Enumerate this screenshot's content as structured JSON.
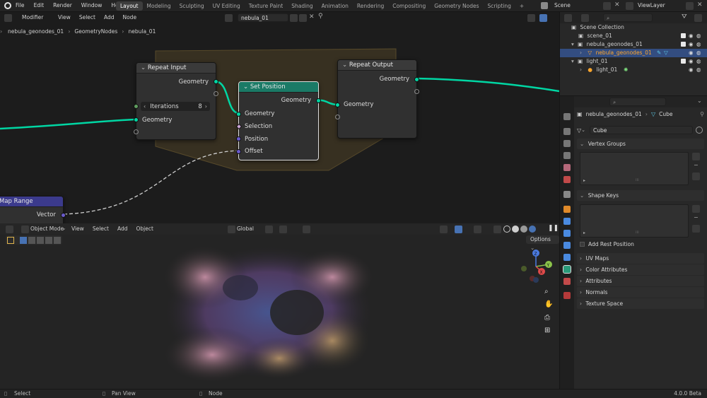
{
  "topbar": {
    "menu": [
      "File",
      "Edit",
      "Render",
      "Window",
      "Help"
    ],
    "workspaces": [
      "Layout",
      "Modeling",
      "Sculpting",
      "UV Editing",
      "Texture Paint",
      "Shading",
      "Animation",
      "Rendering",
      "Compositing",
      "Geometry Nodes",
      "Scripting"
    ],
    "active_workspace": "Layout",
    "add_workspace": "+",
    "scene": "Scene",
    "view_layer": "ViewLayer"
  },
  "node_editor": {
    "header": {
      "editor_type": "Modifier",
      "menus": [
        "View",
        "Select",
        "Add",
        "Node"
      ],
      "node_group": "nebula_01"
    },
    "breadcrumb": [
      "nebula_geonodes_01",
      "GeometryNodes",
      "nebula_01"
    ],
    "nodes": {
      "repeat_input": {
        "title": "Repeat Input",
        "out_geometry": "Geometry",
        "iterations_label": "Iterations",
        "iterations_value": "8",
        "in_geometry": "Geometry"
      },
      "set_position": {
        "title": "Set Position",
        "out_geometry": "Geometry",
        "in_geometry": "Geometry",
        "selection": "Selection",
        "position": "Position",
        "offset": "Offset"
      },
      "repeat_output": {
        "title": "Repeat Output",
        "out_geometry": "Geometry",
        "in_geometry": "Geometry"
      },
      "map_range": {
        "title": "Map Range",
        "out_vector": "Vector"
      }
    },
    "colors": {
      "geometry_link": "#00d6a3",
      "set_position_header": "#1a7a66",
      "map_range_header": "#3b3a8c",
      "frame": "#3b3322"
    }
  },
  "viewport": {
    "mode": "Object Mode",
    "menus": [
      "View",
      "Select",
      "Add",
      "Object"
    ],
    "transform_orientation": "Global",
    "options": "Options",
    "gizmo_axes": [
      "X",
      "Y",
      "Z"
    ]
  },
  "outliner": {
    "root": "Scene Collection",
    "rows": [
      {
        "label": "scene_01",
        "level": 1,
        "icon": "collection-icon"
      },
      {
        "label": "nebula_geonodes_01",
        "level": 1,
        "icon": "collection-icon"
      },
      {
        "label": "nebula_geonodes_01",
        "level": 2,
        "icon": "mesh-icon",
        "selected": true
      },
      {
        "label": "light_01",
        "level": 1,
        "icon": "collection-icon"
      },
      {
        "label": "light_01",
        "level": 2,
        "icon": "light-icon"
      }
    ]
  },
  "properties": {
    "breadcrumb_object": "nebula_geonodes_01",
    "breadcrumb_data": "Cube",
    "mesh_name": "Cube",
    "panels": {
      "vertex_groups": "Vertex Groups",
      "shape_keys": "Shape Keys",
      "add_rest_position": "Add Rest Position",
      "uv_maps": "UV Maps",
      "color_attributes": "Color Attributes",
      "attributes": "Attributes",
      "normals": "Normals",
      "texture_space": "Texture Space"
    }
  },
  "statusbar": {
    "select": "Select",
    "pan_view": "Pan View",
    "node": "Node",
    "version": "4.0.0 Beta"
  }
}
